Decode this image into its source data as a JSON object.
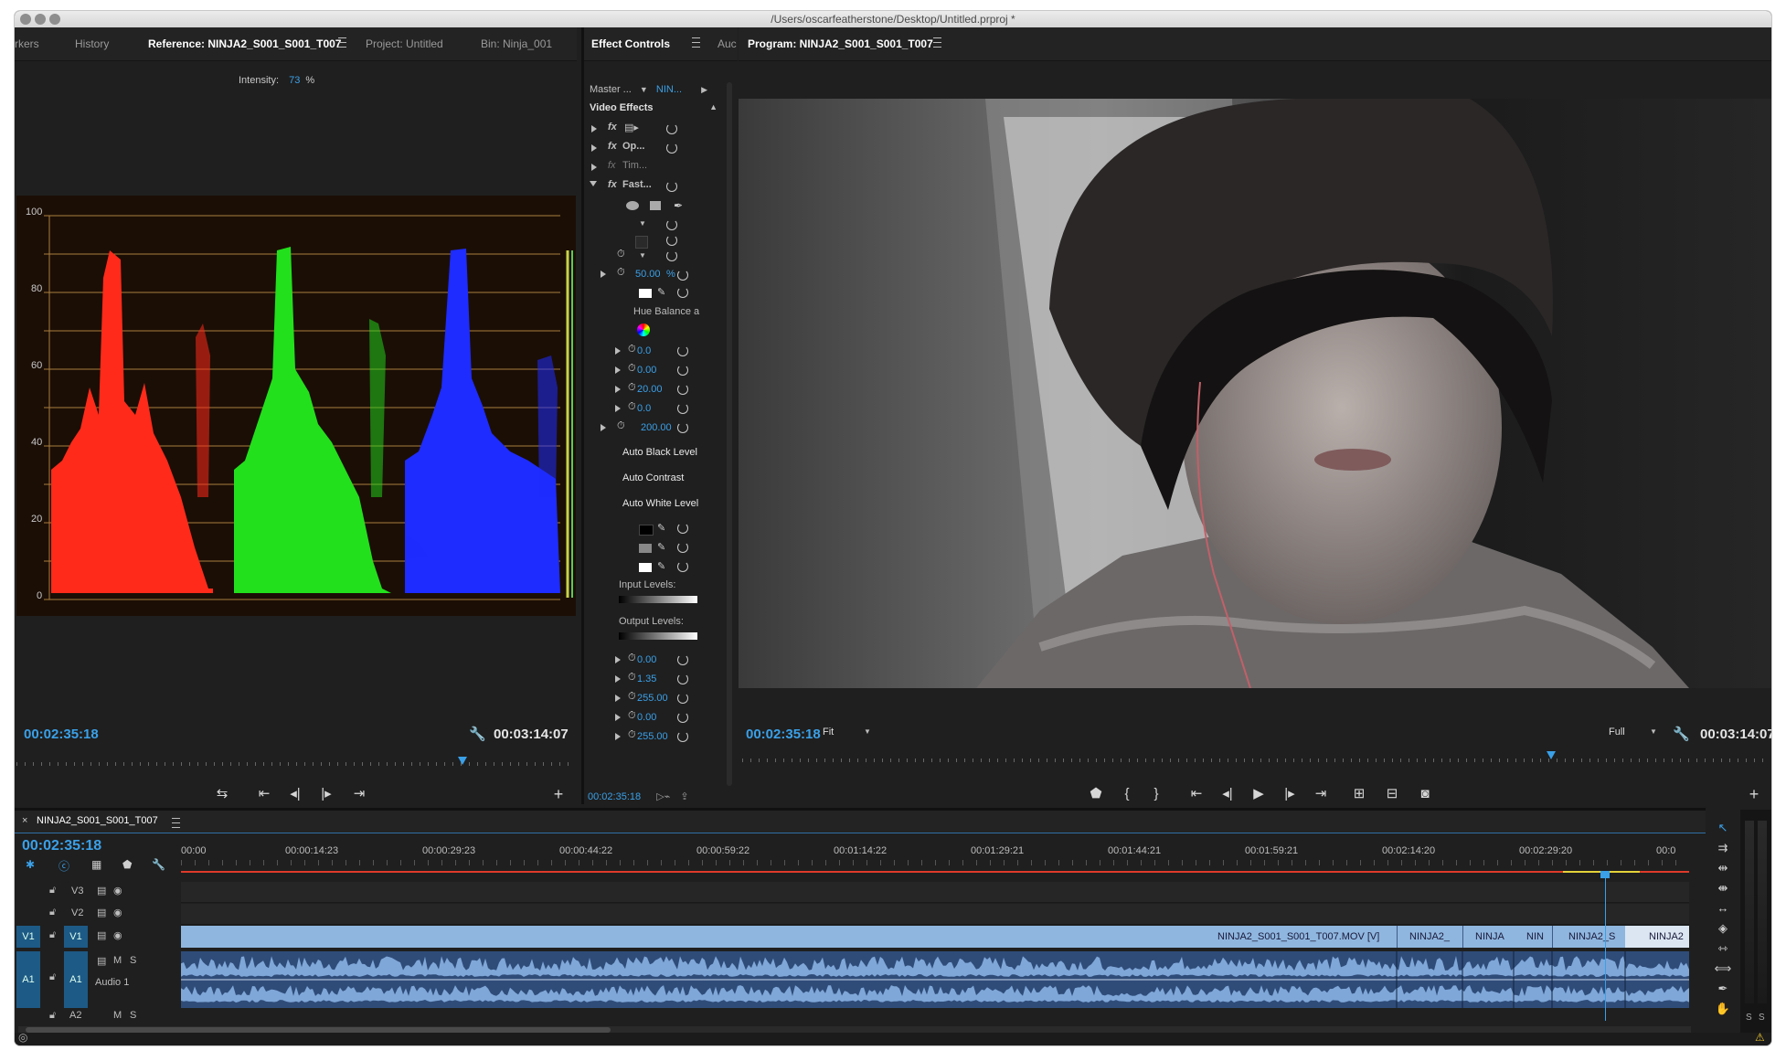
{
  "window": {
    "title": "/Users/oscarfeatherstone/Desktop/Untitled.prproj *"
  },
  "source_panel": {
    "tabs": [
      "rkers",
      "History",
      "Reference: NINJA2_S001_S001_T007",
      "Project: Untitled",
      "Bin: Ninja_001"
    ],
    "intensity_label": "Intensity:",
    "intensity_value": "73",
    "intensity_unit": "%",
    "scope_ticks": [
      "100",
      "80",
      "60",
      "40",
      "20",
      "0"
    ],
    "timecode_current": "00:02:35:18",
    "timecode_duration": "00:03:14:07"
  },
  "effect_controls": {
    "tab": "Effect Controls",
    "tab_next": "Auc",
    "master_label": "Master ...",
    "clip_label": "NIN...",
    "section": "Video Effects",
    "effects": [
      "Op...",
      "Tim...",
      "Fast..."
    ],
    "percent_value": "50.00",
    "percent_unit": "%",
    "hue_balance_label": "Hue Balance a",
    "values_a": [
      "0.0",
      "0.00",
      "20.00",
      "0.0",
      "200.00"
    ],
    "auto_black": "Auto Black Level",
    "auto_contrast": "Auto Contrast",
    "auto_white": "Auto White Level",
    "input_levels": "Input Levels:",
    "output_levels": "Output Levels:",
    "values_b": [
      "0.00",
      "1.35",
      "255.00",
      "0.00",
      "255.00"
    ],
    "timecode": "00:02:35:18"
  },
  "program_monitor": {
    "tab": "Program: NINJA2_S001_S001_T007",
    "timecode_current": "00:02:35:18",
    "fit_option": "Fit",
    "quality_option": "Full",
    "timecode_duration": "00:03:14:07",
    "playhead_fraction": 0.79
  },
  "timeline": {
    "sequence_tab": "NINJA2_S001_S001_T007",
    "timecode": "00:02:35:18",
    "ruler": [
      "00:00",
      "00:00:14:23",
      "00:00:29:23",
      "00:00:44:22",
      "00:00:59:22",
      "00:01:14:22",
      "00:01:29:21",
      "00:01:44:21",
      "00:01:59:21",
      "00:02:14:20",
      "00:02:29:20",
      "00:0"
    ],
    "tracks": {
      "v3": "V3",
      "v2": "V2",
      "v1_source": "V1",
      "v1": "V1",
      "a1_source": "A1",
      "a1": "A1",
      "a1_name": "Audio 1",
      "a2": "A2",
      "m": "M",
      "s": "S"
    },
    "video_clips": [
      "NINJA2_S001_S001_T007.MOV [V]",
      "NINJA2_",
      "NINJA",
      "NIN",
      "NINJA2_S",
      "NINJA2"
    ],
    "playhead_fraction": 0.944
  },
  "meter_labels": [
    "S",
    "S"
  ],
  "colors": {
    "accent_blue": "#3aa0e8",
    "clip_video": "#8fb6df",
    "clip_audio": "#2f4c79",
    "panel_bg": "#1f1f1f",
    "scope_red": "#ff2a1a",
    "scope_green": "#22e01c",
    "scope_blue": "#1e2cff"
  }
}
